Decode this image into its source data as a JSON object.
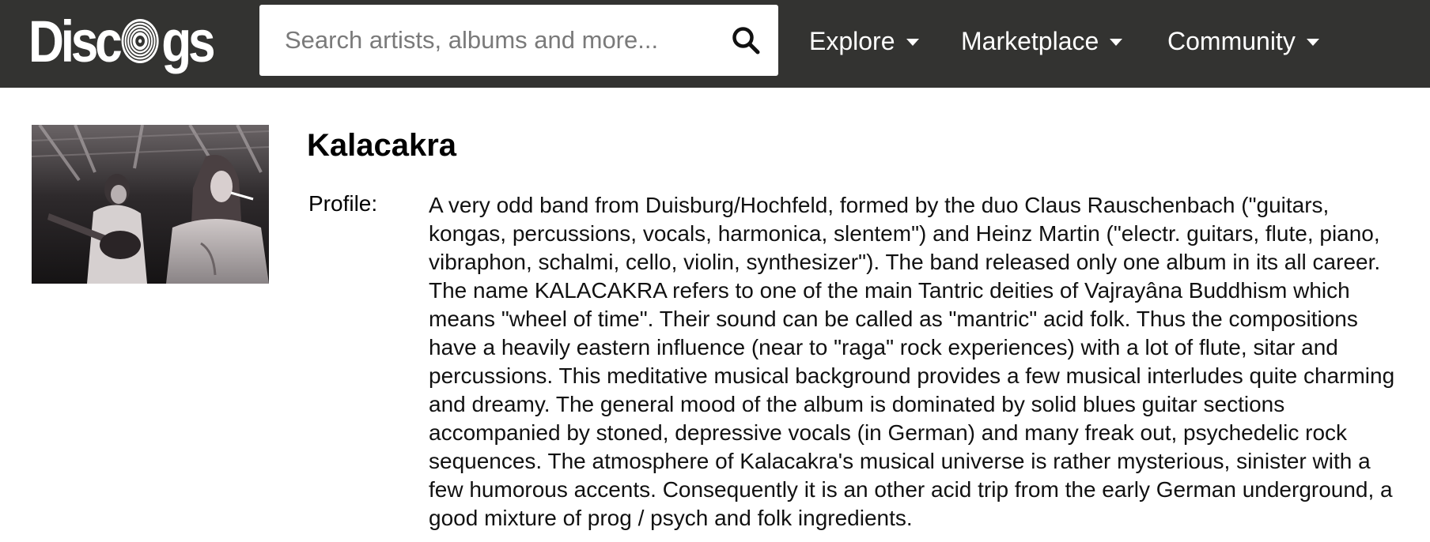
{
  "header": {
    "logo_text_left": "Disc",
    "logo_text_right": "gs",
    "search": {
      "placeholder": "Search artists, albums and more...",
      "value": ""
    },
    "nav": [
      {
        "label": "Explore"
      },
      {
        "label": "Marketplace"
      },
      {
        "label": "Community"
      }
    ]
  },
  "artist": {
    "name": "Kalacakra",
    "profile_label": "Profile:",
    "profile_text": "A very odd band from Duisburg/Hochfeld, formed by the duo Claus Rauschenbach (\"guitars, kongas, percussions, vocals, harmonica, slentem\") and Heinz Martin (\"electr. guitars, flute, piano, vibraphon, schalmi, cello, violin, synthesizer\"). The band released only one album in its all career. The name KALACAKRA refers to one of the main Tantric deities of Vajrayâna Buddhism which means \"wheel of time\". Their sound can be called as \"mantric\" acid folk. Thus the compositions have a heavily eastern influence (near to \"raga\" rock experiences) with a lot of flute, sitar and percussions. This meditative musical background provides a few musical interludes quite charming and dreamy. The general mood of the album is dominated by solid blues guitar sections accompanied by stoned, depressive vocals (in German) and many freak out, psychedelic rock sequences. The atmosphere of Kalacakra's musical universe is rather mysterious, sinister with a few humorous accents. Consequently it is an other acid trip from the early German underground, a good mixture of prog / psych and folk ingredients."
  },
  "colors": {
    "header_bg": "#333331",
    "header_text": "#ffffff",
    "page_bg": "#ffffff"
  },
  "icons": [
    "record-icon",
    "search-icon",
    "caret-down-icon"
  ]
}
